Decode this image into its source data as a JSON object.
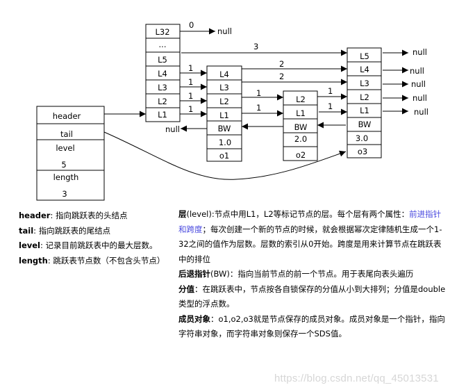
{
  "diagram": {
    "list_struct": {
      "fields": [
        {
          "name": "header",
          "value": ""
        },
        {
          "name": "tail",
          "value": ""
        },
        {
          "name": "level",
          "value": "5"
        },
        {
          "name": "length",
          "value": "3"
        }
      ]
    },
    "header_node": {
      "levels": [
        "L32",
        "...",
        "L5",
        "L4",
        "L3",
        "L2",
        "L1"
      ],
      "spans": {
        "L32": "0",
        "L5": "3",
        "L4": "1",
        "L3": "1",
        "L2": "1",
        "L1": "1"
      },
      "null_label": "null"
    },
    "nodes": [
      {
        "id": "node1",
        "levels": [
          "L4",
          "L3",
          "L2",
          "L1"
        ],
        "backward": "BW",
        "score": "1.0",
        "obj": "o1",
        "spans": {
          "L4": "2",
          "L3": "2",
          "L2": "1",
          "L1": "1"
        }
      },
      {
        "id": "node2",
        "levels": [
          "L2",
          "L1"
        ],
        "backward": "BW",
        "score": "2.0",
        "obj": "o2",
        "spans": {
          "L2": "1",
          "L1": "1"
        }
      },
      {
        "id": "node3",
        "levels": [
          "L5",
          "L4",
          "L3",
          "L2",
          "L1"
        ],
        "backward": "BW",
        "score": "3.0",
        "obj": "o3",
        "spans": {}
      }
    ],
    "null_label": "null"
  },
  "legend_left": [
    {
      "term": "header",
      "sep": ": ",
      "desc": "指向跳跃表的头结点"
    },
    {
      "term": "tail",
      "sep": ": ",
      "desc": "指向跳跃表的尾结点"
    },
    {
      "term": "level",
      "sep": ": ",
      "desc": "记录目前跳跃表中的最大层数。"
    },
    {
      "term": "length",
      "sep": ": ",
      "desc": "跳跃表节点数（不包含头节点）"
    }
  ],
  "legend_right": {
    "level": {
      "term": "层",
      "desc_a": "(level):节点中用L1，L2等标记节点的层。每个层有两个属性：",
      "link": "前进指针和跨度",
      "desc_b": "；每次创建一个新的节点的时候，就会根据幂次定律随机生成一个1-32之间的值作为层数。层数的索引从0开始。跨度是用来计算节点在跳跃表中的排位"
    },
    "backward": {
      "term": "后退指针",
      "desc": "(BW)：指向当前节点的前一个节点。用于表尾向表头遍历"
    },
    "score": {
      "term": "分值",
      "desc": "：在跳跃表中，节点按各自锁保存的分值从小到大排列；分值是double类型的浮点数。"
    },
    "obj": {
      "term": "成员对象",
      "desc": "：o1,o2,o3就是节点保存的成员对象。成员对象是一个指针，指向字符串对象，而字符串对象则保存一个SDS值。"
    }
  },
  "watermark": "https://blog.csdn.net/qq_45013531"
}
